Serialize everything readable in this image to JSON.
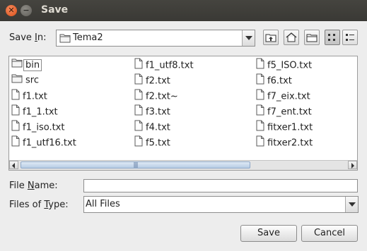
{
  "window": {
    "title": "Save"
  },
  "save_in": {
    "label_pre": "Save ",
    "label_mn": "I",
    "label_post": "n:",
    "value": "Tema2"
  },
  "files": [
    {
      "name": "bin",
      "type": "folder",
      "selected": true
    },
    {
      "name": "src",
      "type": "folder",
      "selected": false
    },
    {
      "name": "f1.txt",
      "type": "file"
    },
    {
      "name": "f1_1.txt",
      "type": "file"
    },
    {
      "name": "f1_iso.txt",
      "type": "file"
    },
    {
      "name": "f1_utf16.txt",
      "type": "file"
    },
    {
      "name": "f1_utf8.txt",
      "type": "file"
    },
    {
      "name": "f2.txt",
      "type": "file"
    },
    {
      "name": "f2.txt~",
      "type": "file"
    },
    {
      "name": "f3.txt",
      "type": "file"
    },
    {
      "name": "f4.txt",
      "type": "file"
    },
    {
      "name": "f5.txt",
      "type": "file"
    },
    {
      "name": "f5_ISO.txt",
      "type": "file"
    },
    {
      "name": "f6.txt",
      "type": "file"
    },
    {
      "name": "f7_eix.txt",
      "type": "file"
    },
    {
      "name": "f7_ent.txt",
      "type": "file"
    },
    {
      "name": "fitxer1.txt",
      "type": "file"
    },
    {
      "name": "fitxer2.txt",
      "type": "file"
    }
  ],
  "file_name": {
    "label_pre": "File ",
    "label_mn": "N",
    "label_post": "ame:",
    "value": ""
  },
  "files_of_type": {
    "label_pre": "Files of ",
    "label_mn": "T",
    "label_post": "ype:",
    "value": "All Files"
  },
  "buttons": {
    "save": "Save",
    "cancel": "Cancel"
  }
}
